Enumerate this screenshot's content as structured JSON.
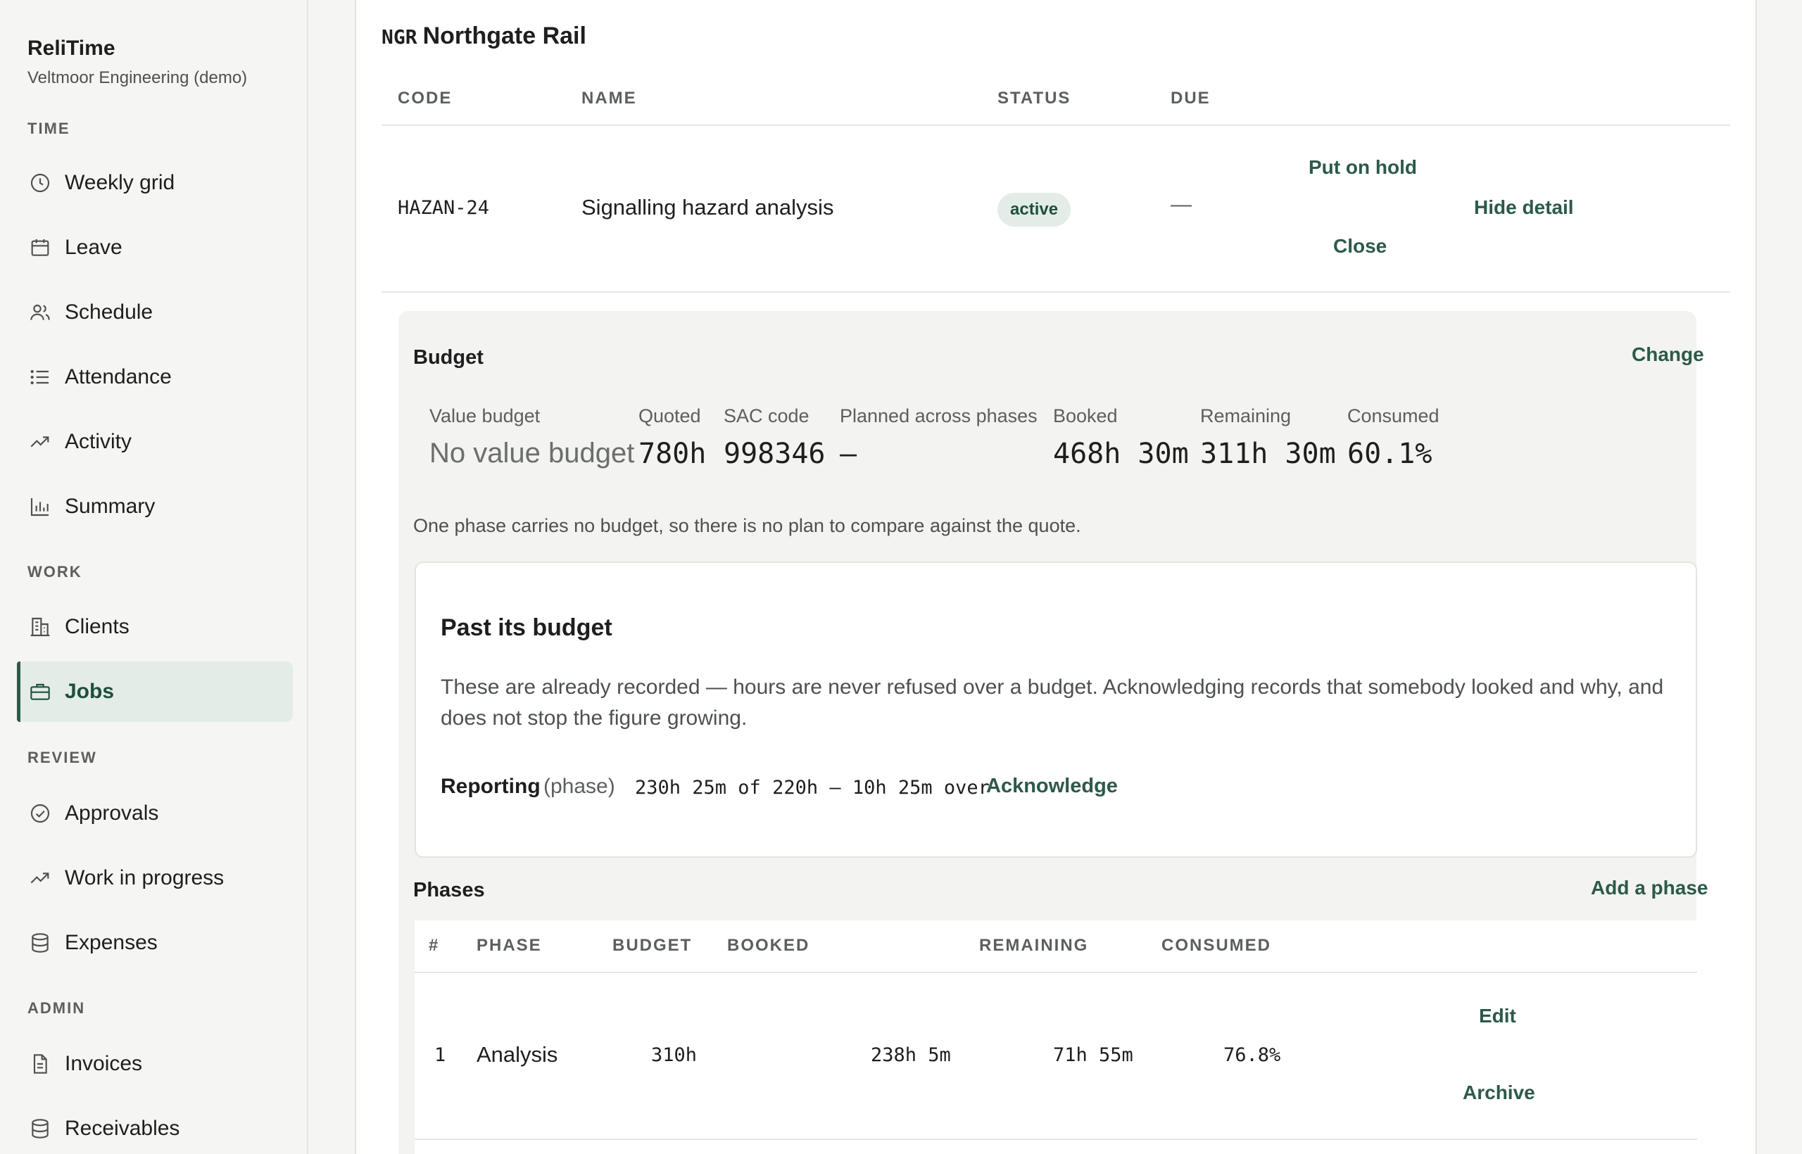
{
  "app": {
    "name": "ReliTime",
    "org": "Veltmoor Engineering (demo)"
  },
  "sidebar": {
    "sections": [
      {
        "label": "TIME",
        "items": [
          "Weekly grid",
          "Leave",
          "Schedule",
          "Attendance",
          "Activity",
          "Summary"
        ]
      },
      {
        "label": "WORK",
        "items": [
          "Clients",
          "Jobs"
        ]
      },
      {
        "label": "REVIEW",
        "items": [
          "Approvals",
          "Work in progress",
          "Expenses"
        ]
      },
      {
        "label": "ADMIN",
        "items": [
          "Invoices",
          "Receivables"
        ]
      }
    ],
    "active_item": "Jobs"
  },
  "client": {
    "code": "NGR",
    "name": "Northgate Rail"
  },
  "jobs_table": {
    "headers": {
      "code": "CODE",
      "name": "NAME",
      "status": "STATUS",
      "due": "DUE"
    },
    "row": {
      "code": "HAZAN-24",
      "name": "Signalling hazard analysis",
      "status": "active",
      "due": "—",
      "actions": {
        "hold": "Put on hold",
        "close": "Close",
        "detail": "Hide detail"
      }
    }
  },
  "budget": {
    "title": "Budget",
    "change_label": "Change",
    "stats": {
      "value_budget": {
        "label": "Value budget",
        "value": "No value budget"
      },
      "quoted": {
        "label": "Quoted",
        "value": "780h"
      },
      "sac_code": {
        "label": "SAC code",
        "value": "998346"
      },
      "planned": {
        "label": "Planned across phases",
        "value": "—"
      },
      "booked": {
        "label": "Booked",
        "value": "468h 30m"
      },
      "remaining": {
        "label": "Remaining",
        "value": "311h 30m"
      },
      "consumed": {
        "label": "Consumed",
        "value": "60.1%"
      }
    },
    "note": "One phase carries no budget, so there is no plan to compare against the quote."
  },
  "alert": {
    "title": "Past its budget",
    "body": "These are already recorded — hours are never refused over a budget. Acknowledging records that somebody looked and why, and does not stop the figure growing.",
    "item": {
      "name": "Reporting",
      "kind": "(phase)",
      "figures": "230h 25m of 220h — 10h 25m over",
      "action": "Acknowledge"
    }
  },
  "phases": {
    "title": "Phases",
    "add_label": "Add a phase",
    "headers": {
      "num": "#",
      "phase": "PHASE",
      "budget": "BUDGET",
      "booked": "BOOKED",
      "remaining": "REMAINING",
      "consumed": "CONSUMED"
    },
    "rows": [
      {
        "num": "1",
        "phase": "Analysis",
        "budget": "310h",
        "booked": "238h 5m",
        "remaining": "71h 55m",
        "consumed": "76.8%",
        "edit": "Edit",
        "archive": "Archive"
      }
    ]
  }
}
